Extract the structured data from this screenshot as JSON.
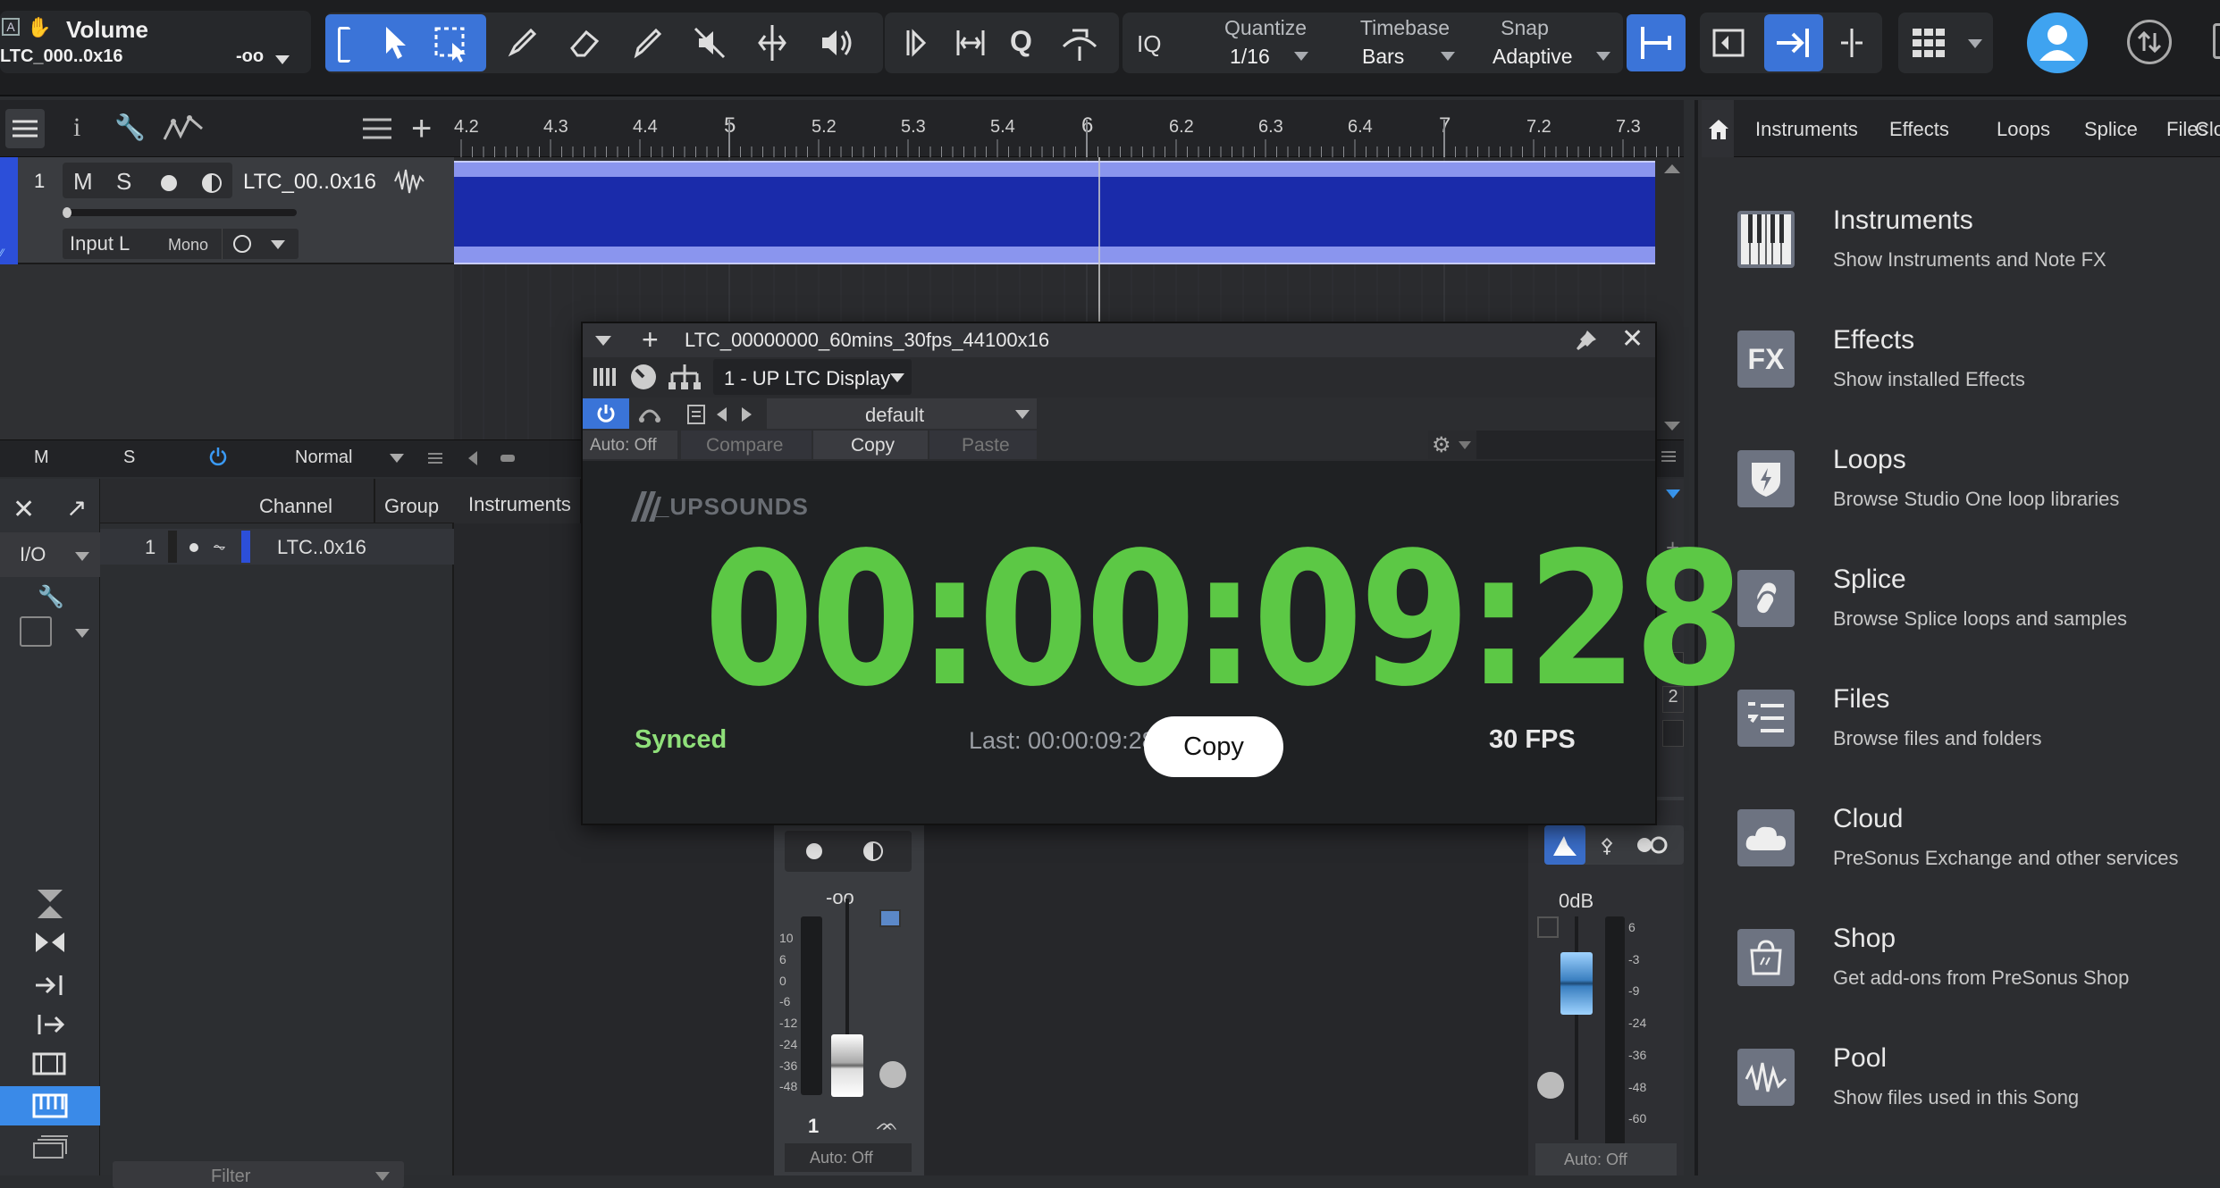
{
  "toolbar": {
    "track_name": "Volume",
    "track_sub": "LTC_000..0x16",
    "track_value": "-oo",
    "quantize_label": "Quantize",
    "quantize_value": "1/16",
    "timebase_label": "Timebase",
    "timebase_value": "Bars",
    "snap_label": "Snap",
    "snap_value": "Adaptive",
    "iq_label": "IQ",
    "q_label": "Q"
  },
  "arrange": {
    "ruler_ticks": [
      "4.2",
      "4.3",
      "4.4",
      "5",
      "5.2",
      "5.3",
      "5.4",
      "6",
      "6.2",
      "6.3",
      "6.4",
      "7",
      "7.2",
      "7.3"
    ],
    "track": {
      "number": "1",
      "mute": "M",
      "solo": "S",
      "name": "LTC_00..0x16",
      "input": "Input L",
      "mode": "Mono"
    },
    "footer": {
      "m": "M",
      "s": "S",
      "mode": "Normal"
    }
  },
  "console": {
    "col_channel": "Channel",
    "col_group": "Group",
    "instruments_tab": "Instruments",
    "io_label": "I/O",
    "row_number": "1",
    "row_name": "LTC..0x16",
    "filter_placeholder": "Filter",
    "strip1": {
      "value": "-oo",
      "number": "1",
      "auto": "Auto: Off",
      "scale": [
        "10",
        "6",
        "0",
        "-6",
        "-12",
        "-24",
        "-36",
        "-48"
      ]
    },
    "strip2": {
      "value": "0dB",
      "auto": "Auto: Off",
      "scale": [
        "6",
        "-3",
        "-9",
        "-24",
        "-36",
        "-48",
        "-60"
      ],
      "side_num": "2"
    }
  },
  "plugin": {
    "title": "LTC_00000000_60mins_30fps_44100x16",
    "insert": "1 - UP LTC Display",
    "preset": "default",
    "auto": "Auto: Off",
    "compare": "Compare",
    "copy": "Copy",
    "paste": "Paste",
    "brand": "_UPSOUNDS",
    "timecode": "00:00:09:28",
    "status": "Synced",
    "last": "Last: 00:00:09:28",
    "copy_button": "Copy",
    "fps": "30 FPS",
    "timecode_color": "#5cc845"
  },
  "browser": {
    "tabs": [
      "Instruments",
      "Effects",
      "Loops",
      "Splice",
      "Files",
      "Clo"
    ],
    "items": [
      {
        "title": "Instruments",
        "desc": "Show Instruments and Note FX",
        "icon": "piano-icon"
      },
      {
        "title": "Effects",
        "desc": "Show installed Effects",
        "icon": "fx-icon"
      },
      {
        "title": "Loops",
        "desc": "Browse Studio One loop libraries",
        "icon": "loops-icon"
      },
      {
        "title": "Splice",
        "desc": "Browse Splice loops and samples",
        "icon": "splice-icon"
      },
      {
        "title": "Files",
        "desc": "Browse files and folders",
        "icon": "files-icon"
      },
      {
        "title": "Cloud",
        "desc": "PreSonus Exchange and other services",
        "icon": "cloud-icon"
      },
      {
        "title": "Shop",
        "desc": "Get add-ons from PreSonus Shop",
        "icon": "shop-icon"
      },
      {
        "title": "Pool",
        "desc": "Show files used in this Song",
        "icon": "pool-icon"
      }
    ]
  }
}
